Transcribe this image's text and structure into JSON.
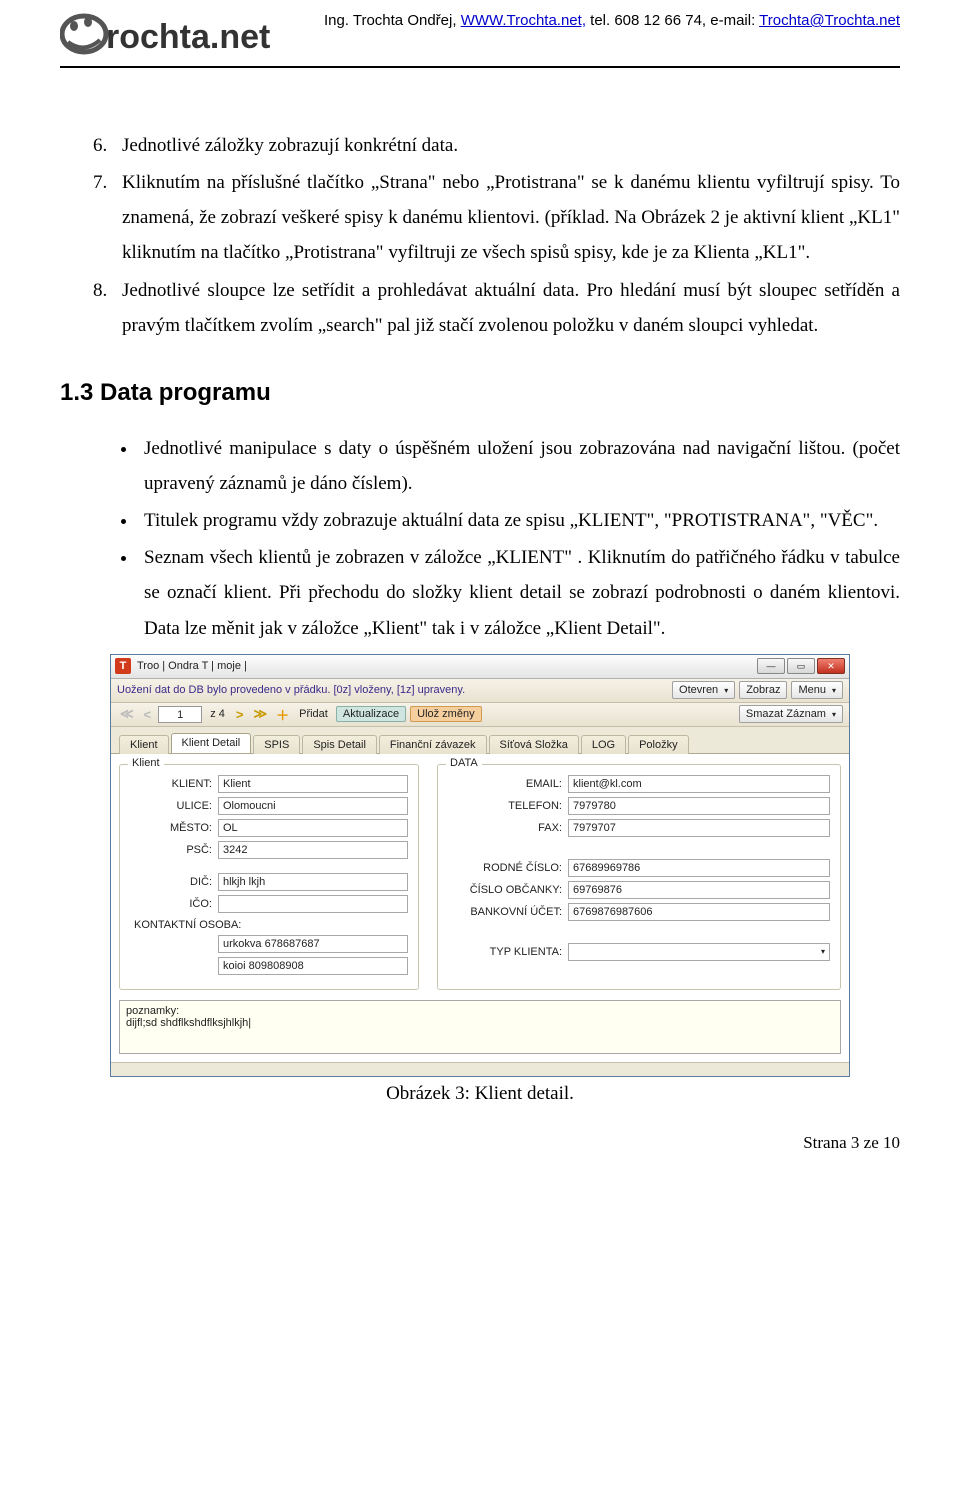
{
  "header": {
    "name_prefix": "Ing. Trochta Ondřej, ",
    "www": "WWW.Trochta.net,",
    "tel": " tel. 608 12 66 74, e-mail: ",
    "email": "Trochta@Trochta.net",
    "logo_text": "rochta.net"
  },
  "list": {
    "li6": "Jednotlivé záložky zobrazují konkrétní data.",
    "li7": "Kliknutím na příslušné tlačítko „Strana\" nebo „Protistrana\" se k danému klientu vyfiltrují spisy. To znamená, že zobrazí veškeré spisy k danému klientovi. (příklad. Na Obrázek 2 je aktivní klient „KL1\"  kliknutím na tlačítko „Protistrana\" vyfiltruji ze všech spisů spisy, kde je za Klienta „KL1\".",
    "li8": "Jednotlivé sloupce lze setřídit a prohledávat aktuální data. Pro hledání musí být sloupec setříděn a pravým tlačítkem zvolím „search\" pal již stačí zvolenou položku v daném sloupci vyhledat."
  },
  "section": {
    "heading": "1.3  Data programu",
    "b1": "Jednotlivé manipulace s daty o úspěšném uložení jsou zobrazována nad navigační lištou. (počet upravený záznamů je dáno číslem).",
    "b2": "Titulek programu vždy zobrazuje aktuální data ze spisu „KLIENT\", \"PROTISTRANA\", \"VĚC\".",
    "b3": "Seznam všech klientů je zobrazen v záložce „KLIENT\" . Kliknutím do patřičného řádku v tabulce se označí klient. Při přechodu do složky klient detail se zobrazí podrobnosti o daném klientovi. Data lze měnit jak v záložce „Klient\" tak i v záložce „Klient Detail\"."
  },
  "shot": {
    "title": "Troo | Ondra        T | moje |",
    "status_msg": "Uožení dat do DB bylo provedeno v přádku. [0z] vloženy, [1z] upraveny.",
    "combo_otevren": "Otevren",
    "btn_zobraz": "Zobraz",
    "btn_menu": "Menu",
    "nav": {
      "page": "1",
      "z4": "z 4",
      "pridat": "Přidat",
      "akt": "Aktualizace",
      "uloz": "Ulož změny",
      "smazat": "Smazat Záznam"
    },
    "tabs": [
      "Klient",
      "Klient Detail",
      "SPIS",
      "Spis Detail",
      "Finanční závazek",
      "Síťová Složka",
      "LOG",
      "Položky"
    ],
    "left": {
      "legend": "Klient",
      "klient_l": "KLIENT:",
      "klient_v": "Klient",
      "ulice_l": "ULICE:",
      "ulice_v": "Olomoucni",
      "mesto_l": "MĚSTO:",
      "mesto_v": "OL",
      "psc_l": "PSČ:",
      "psc_v": "3242",
      "dic_l": "DIČ:",
      "dic_v": "hlkjh lkjh",
      "ico_l": "IČO:",
      "ico_v": "",
      "kontakt_l": "KONTAKTNÍ OSOBA:",
      "kontakt_v1": "urkokva 678687687",
      "kontakt_v2": "koioi 809808908"
    },
    "right": {
      "legend": "DATA",
      "email_l": "EMAIL:",
      "email_v": "klient@kl.com",
      "tel_l": "TELEFON:",
      "tel_v": "7979780",
      "fax_l": "FAX:",
      "fax_v": "7979707",
      "rc_l": "RODNÉ ČÍSLO:",
      "rc_v": "67689969786",
      "co_l": "ČÍSLO OBČANKY:",
      "co_v": "69769876",
      "bu_l": "BANKOVNÍ ÚČET:",
      "bu_v": "6769876987606",
      "typ_l": "TYP KLIENTA:",
      "typ_v": ""
    },
    "notes_l": "poznamky:",
    "notes_v": "dijfl;sd shdflkshdflksjhlkjh|"
  },
  "caption": "Obrázek 3: Klient detail.",
  "footer": "Strana 3 ze 10"
}
